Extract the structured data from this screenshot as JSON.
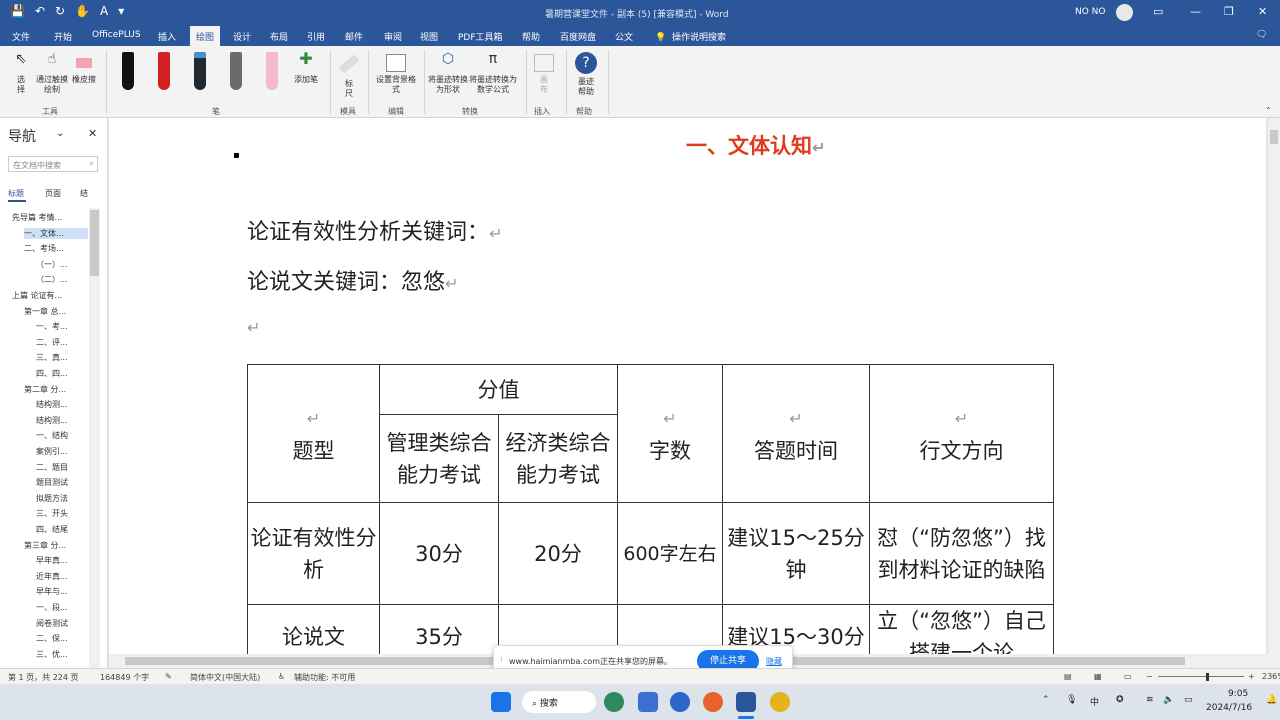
{
  "window": {
    "title": "暑期营课堂文件 - 副本 (5) [兼容模式] - Word",
    "user": "NO NO",
    "wc_icons": [
      "ribbon-display-icon",
      "minimize-icon",
      "restore-icon",
      "close-icon"
    ]
  },
  "tabs": [
    "文件",
    "开始",
    "OfficePLUS",
    "插入",
    "绘图",
    "设计",
    "布局",
    "引用",
    "邮件",
    "审阅",
    "视图",
    "PDF工具箱",
    "帮助",
    "百度网盘",
    "公文"
  ],
  "active_tab": "绘图",
  "search_label": "操作说明搜索",
  "ribbon": {
    "select": "选择",
    "touch_draw": "通过触摸绘制",
    "eraser": "橡皮擦",
    "group_tools": "工具",
    "add_pen": "添加笔",
    "group_pens": "笔",
    "ruler": "标尺",
    "group_stencils": "模具",
    "background": "设置背景格式",
    "group_edit": "编辑",
    "ink_to_shape": "将墨迹转换为形状",
    "ink_to_math": "将墨迹转换为数学公式",
    "group_convert": "转换",
    "canvas_btn": "画布",
    "group_insert": "插入",
    "ink_help": "墨迹帮助",
    "group_help": "帮助"
  },
  "pens": [
    {
      "color": "#111111",
      "tip": "#111111"
    },
    {
      "color": "#d32020",
      "tip": "#d32020"
    },
    {
      "color": "#202830",
      "tip": "#4a90c8"
    },
    {
      "color": "#6a6a6a",
      "tip": "#6a6a6a"
    },
    {
      "color": "#f7b8c8",
      "tip": "#f7b8c8"
    }
  ],
  "nav": {
    "title": "导航",
    "search_placeholder": "在文档中搜索",
    "tabs": [
      "标题",
      "页面",
      "结"
    ],
    "items": [
      "先导篇 考情...",
      "一、文体...",
      "二、考场...",
      "（一）...",
      "（二）...",
      "上篇 论证有...",
      "第一章 总...",
      "一、考...",
      "二、评...",
      "三、真...",
      "四、四...",
      "第二章 分...",
      "结构测...",
      "结构测...",
      "一、结构",
      "案例引...",
      "二、题目",
      "题目测试",
      "拟题方法",
      "三、开头",
      "四、结尾",
      "第三章 分...",
      "早年真...",
      "近年真...",
      "早年与...",
      "一、段...",
      "阅卷测试",
      "二、保...",
      "三、优..."
    ]
  },
  "doc": {
    "heading": "一、文体认知",
    "line1": "论证有效性分析关键词：",
    "line2": "论说文关键词：忽悠",
    "return_mark": "↵",
    "bullet": "▪",
    "table": {
      "h_type": "题型",
      "h_score": "分值",
      "h_mgmt": "管理类综合能力考试",
      "h_econ": "经济类综合能力考试",
      "h_words": "字数",
      "h_time": "答题时间",
      "h_direction": "行文方向",
      "rows": [
        {
          "type": "论证有效性分析",
          "mgmt": "30分",
          "econ": "20分",
          "words": "600字左右",
          "time": "建议15～25分钟",
          "direction": "怼（“防忽悠”）找到材料论证的缺陷"
        },
        {
          "type": "论说文",
          "mgmt": "35分",
          "econ": "",
          "words": "",
          "time": "建议15～30分",
          "direction": "立（“忽悠”）自己搭建一个论"
        }
      ]
    }
  },
  "share_bar": {
    "text": "www.haimianmba.com正在共享您的屏幕。",
    "stop": "停止共享",
    "hide": "隐藏"
  },
  "status": {
    "page": "第 1 页，共 224 页",
    "words": "164849 个字",
    "lang": "简体中文(中国大陆)",
    "access": "辅助功能: 不可用",
    "zoom": "236%"
  },
  "taskbar": {
    "search": "搜索",
    "ime": "中",
    "time": "9:05",
    "date": "2024/7/16"
  }
}
